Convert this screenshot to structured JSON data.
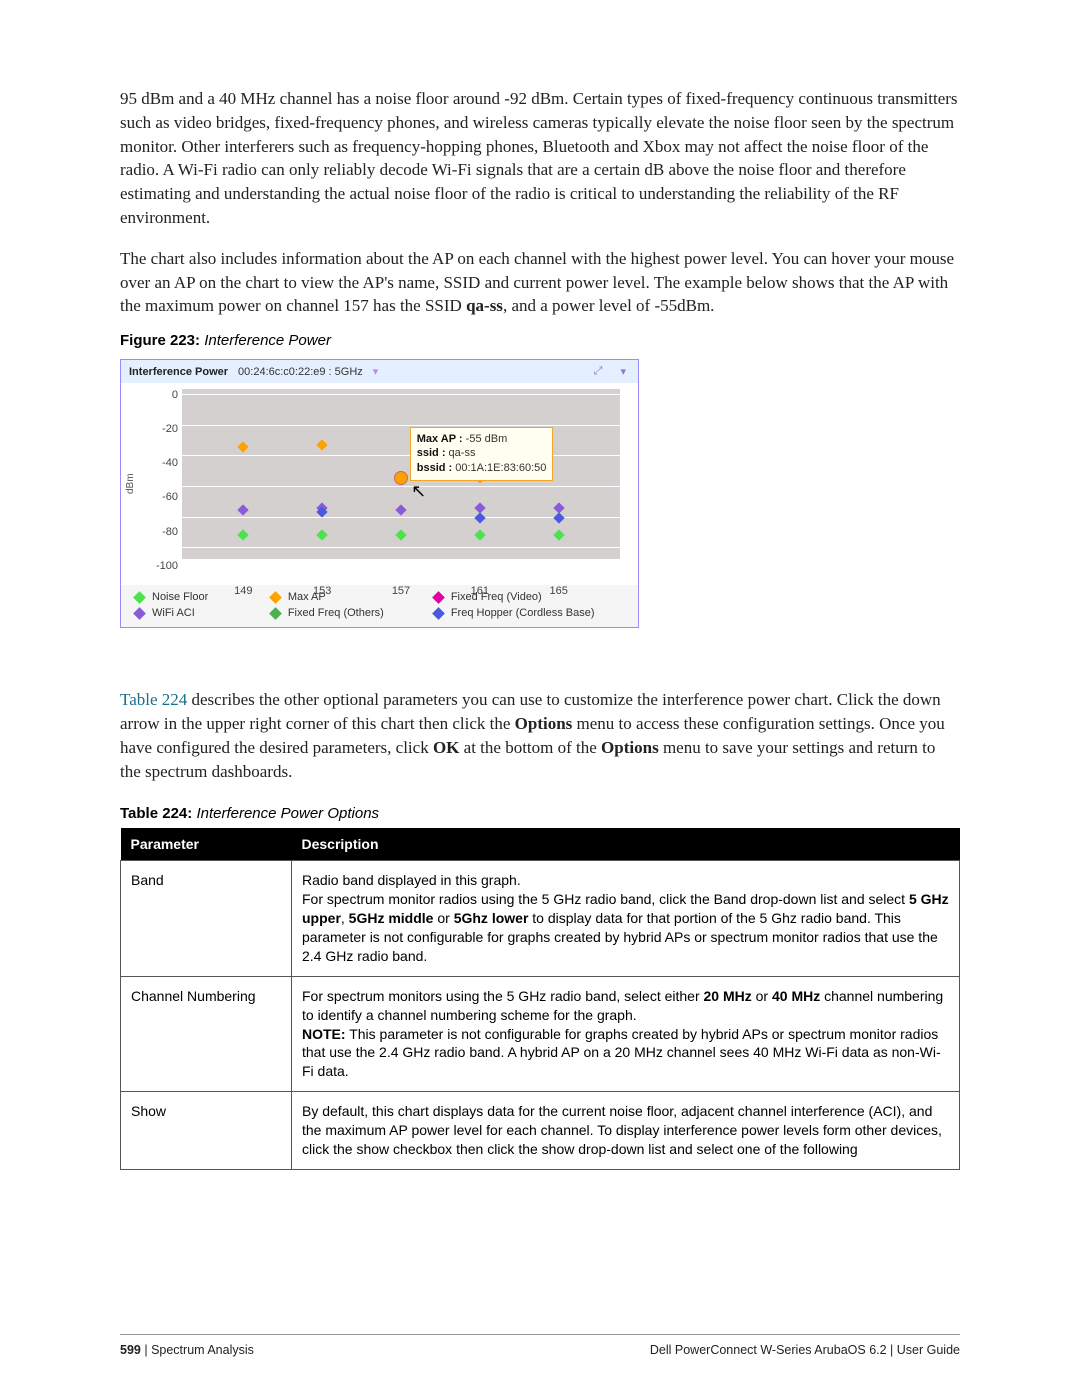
{
  "paragraphs": {
    "p1": "95 dBm and a 40 MHz channel has a noise floor around -92 dBm. Certain types of fixed-frequency continuous transmitters such as video bridges, fixed-frequency phones, and wireless cameras typically elevate the noise floor seen by the spectrum monitor. Other interferers such as frequency-hopping phones, Bluetooth and Xbox may not affect the noise floor of the radio. A Wi-Fi radio can only reliably decode Wi-Fi signals that are a certain dB above the noise floor and therefore estimating and understanding the actual noise floor of the radio is critical to understanding the reliability of the RF environment.",
    "p2_a": "The chart also includes information about the AP on each channel with the highest power level. You can hover your mouse over an AP on the chart to view the AP's name, SSID and current power level. The example below shows that the AP with the maximum power on channel 157 has the SSID ",
    "p2_ssid": "qa-ss",
    "p2_b": ", and a power level of -55dBm.",
    "p3_a": "Table 224",
    "p3_b": " describes the other optional parameters you can use to customize the interference power chart. Click the down arrow in the upper right corner of this chart then click the ",
    "p3_opt": "Options",
    "p3_c": " menu to access these configuration settings. Once you have configured the desired parameters, click ",
    "p3_ok": "OK",
    "p3_d": " at the bottom of the ",
    "p3_opt2": "Options",
    "p3_e": " menu to save your settings and return to the spectrum dashboards."
  },
  "figure": {
    "label": "Figure 223:",
    "title": "Interference Power"
  },
  "chart_panel": {
    "title_bold": "Interference Power",
    "title_rest": "00:24:6c:c0:22:e9 : 5GHz",
    "ylabel": "dBm",
    "tooltip": {
      "l1a": "Max AP :",
      "l1b": " -55 dBm",
      "l2a": "ssid :",
      "l2b": " qa-ss",
      "l3a": "bssid :",
      "l3b": " 00:1A:1E:83:60:50"
    },
    "legend": {
      "noise": "Noise Floor",
      "maxap": "Max AP",
      "ffv": "Fixed Freq (Video)",
      "wifi": "WiFi ACI",
      "ffo": "Fixed Freq (Others)",
      "fhop": "Freq Hopper (Cordless Base)"
    }
  },
  "chart_data": {
    "type": "scatter",
    "xlabel": "",
    "ylabel": "dBm",
    "categories": [
      149,
      153,
      157,
      161,
      165
    ],
    "ylim": [
      -110,
      0
    ],
    "yticks": [
      0,
      -20,
      -40,
      -60,
      -80,
      -100
    ],
    "series": [
      {
        "name": "Noise Floor",
        "color": "#4ce24c",
        "values": [
          -92,
          -92,
          -92,
          -92,
          -92
        ]
      },
      {
        "name": "WiFi ACI",
        "color": "#8a5bd6",
        "values": [
          -75,
          -74,
          -75,
          -74,
          -74
        ]
      },
      {
        "name": "Max AP",
        "color": "#ffa200",
        "values": [
          -35,
          -34,
          -55,
          -55,
          null
        ]
      },
      {
        "name": "Freq Hopper (Cordless Base)",
        "color": "#4a5ae0",
        "values": [
          null,
          -76,
          null,
          -80,
          -80
        ]
      }
    ],
    "tooltip_point": {
      "x": 157,
      "series": "Max AP",
      "value": -55,
      "ssid": "qa-ss",
      "bssid": "00:1A:1E:83:60:50"
    }
  },
  "table": {
    "label": "Table 224:",
    "title": "Interference Power Options",
    "head_param": "Parameter",
    "head_desc": "Description",
    "rows": [
      {
        "param": "Band",
        "desc_a": "Radio band displayed in this graph.\nFor spectrum monitor radios using the 5 GHz radio band, click the Band drop-down list and select ",
        "bold1": "5 GHz upper",
        "mid1": ", ",
        "bold2": "5GHz middle",
        "mid2": " or ",
        "bold3": "5Ghz lower",
        "desc_b": " to display data for that portion of the 5 Ghz radio band. This parameter is not configurable for graphs created by hybrid APs or spectrum monitor radios that use the 2.4 GHz radio band."
      },
      {
        "param": "Channel Numbering",
        "desc_a": "For spectrum monitors using the 5 GHz radio band, select either ",
        "bold1": "20 MHz",
        "mid1": " or ",
        "bold2": "40 MHz",
        "desc_b": " channel numbering to identify a channel numbering scheme for the graph.\n",
        "note_lbl": "NOTE:",
        "note_txt": " This parameter is not configurable for graphs created by hybrid APs or spectrum monitor radios that use the 2.4 GHz radio band. A hybrid AP on a 20 MHz channel sees 40 MHz Wi-Fi data as non-Wi-Fi data."
      },
      {
        "param": "Show",
        "desc_a": "By default, this chart displays data for the current noise floor, adjacent channel interference (ACI), and the maximum AP power level for each channel. To display interference power levels form other devices, click the show checkbox then click the show drop-down list and select one of the following"
      }
    ]
  },
  "footer": {
    "page": "599",
    "section": "Spectrum Analysis",
    "right": "Dell PowerConnect W-Series ArubaOS 6.2  |  User Guide",
    "sep": " | "
  }
}
